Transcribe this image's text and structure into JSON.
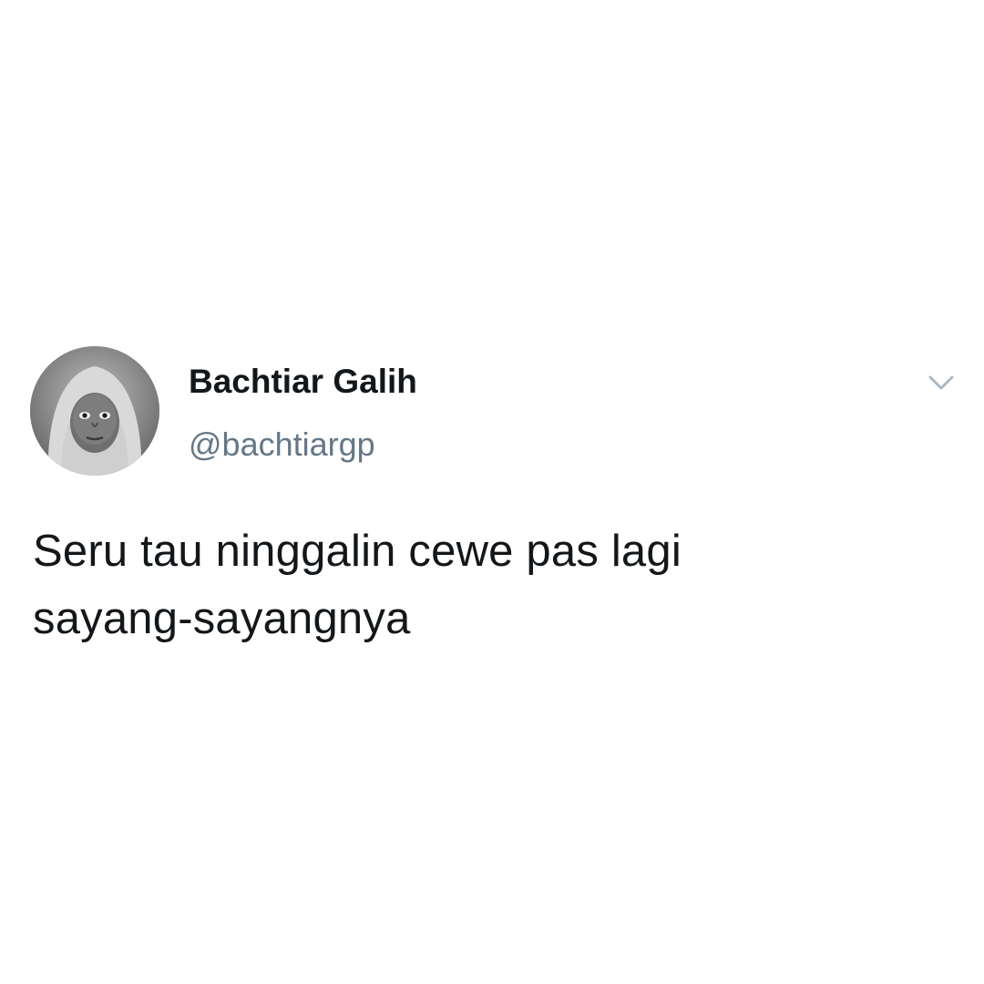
{
  "tweet": {
    "author": {
      "display_name": "Bachtiar Galih",
      "handle": "@bachtiargp",
      "avatar_icon": "avatar-photo-grayscale"
    },
    "text_lines": [
      "Seru tau ninggalin cewe pas lagi",
      "sayang-sayangnya"
    ],
    "menu_icon": "chevron-down-icon"
  },
  "colors": {
    "background": "#ffffff",
    "text_primary": "#14171a",
    "text_secondary": "#657786",
    "caret": "#aab8c2"
  }
}
